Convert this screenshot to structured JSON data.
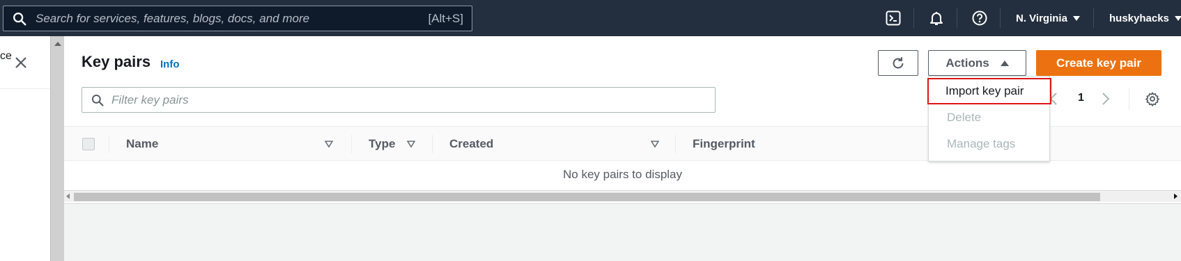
{
  "topbar": {
    "search_placeholder": "Search for services, features, blogs, docs, and more",
    "search_shortcut": "[Alt+S]",
    "region": "N. Virginia",
    "user": "huskyhacks"
  },
  "leftpanel": {
    "partial_text": "ce"
  },
  "page": {
    "title": "Key pairs",
    "info_link": "Info",
    "filter_placeholder": "Filter key pairs",
    "actions_label": "Actions",
    "create_label": "Create key pair",
    "page_number": "1",
    "empty_message": "No key pairs to display"
  },
  "table": {
    "columns": [
      "Name",
      "Type",
      "Created",
      "Fingerprint"
    ]
  },
  "actions_menu": {
    "items": [
      "Import key pair",
      "Delete",
      "Manage tags"
    ]
  },
  "colors": {
    "topbar_bg": "#232f3e",
    "primary_button": "#ec7211",
    "link": "#0073bb",
    "highlight_box": "#e01515"
  }
}
